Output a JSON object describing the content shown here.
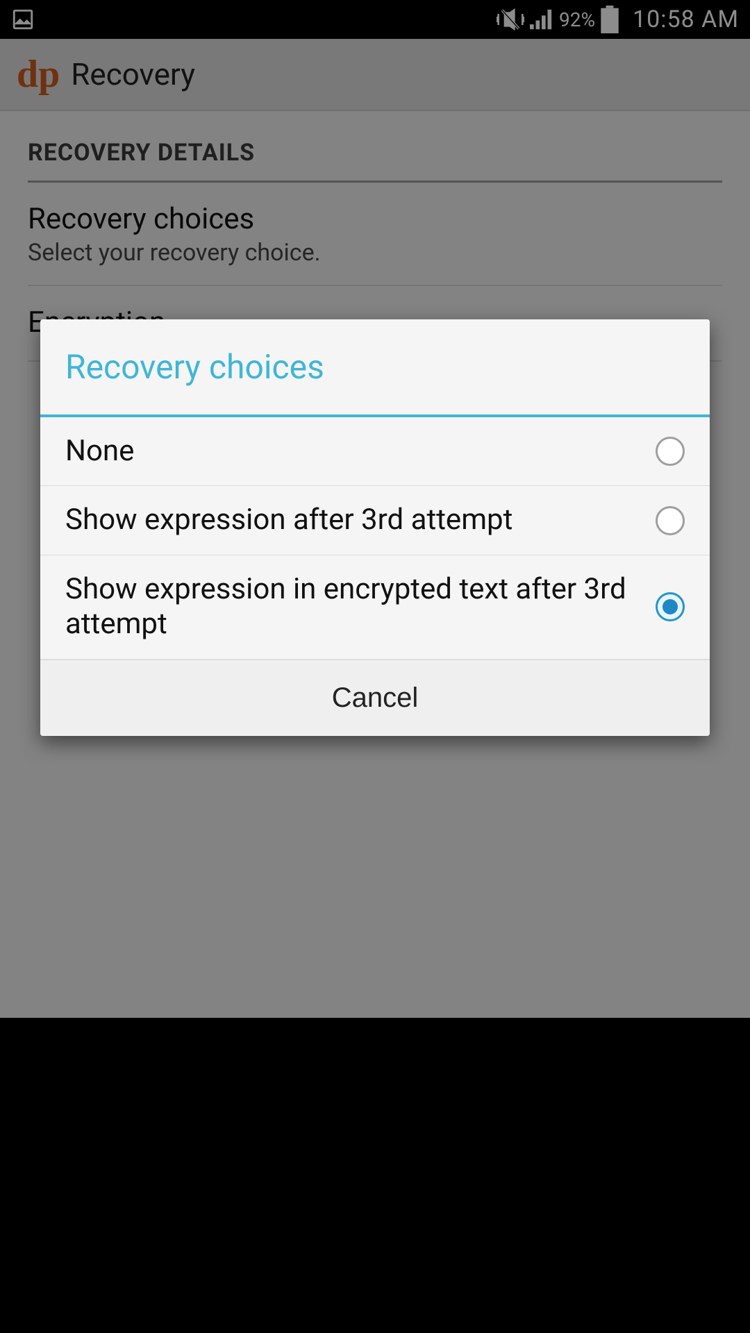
{
  "status": {
    "battery_pct": "92%",
    "time": "10:58 AM"
  },
  "app": {
    "logo": "dp",
    "title": "Recovery"
  },
  "section_header": "RECOVERY DETAILS",
  "settings": [
    {
      "title": "Recovery choices",
      "subtitle": "Select your recovery choice."
    },
    {
      "title": "Encryption",
      "subtitle": ""
    }
  ],
  "dialog": {
    "title": "Recovery choices",
    "options": [
      {
        "label": "None",
        "selected": false
      },
      {
        "label": "Show expression after 3rd attempt",
        "selected": false
      },
      {
        "label": "Show expression in encrypted text after 3rd attempt",
        "selected": true
      }
    ],
    "cancel": "Cancel"
  }
}
